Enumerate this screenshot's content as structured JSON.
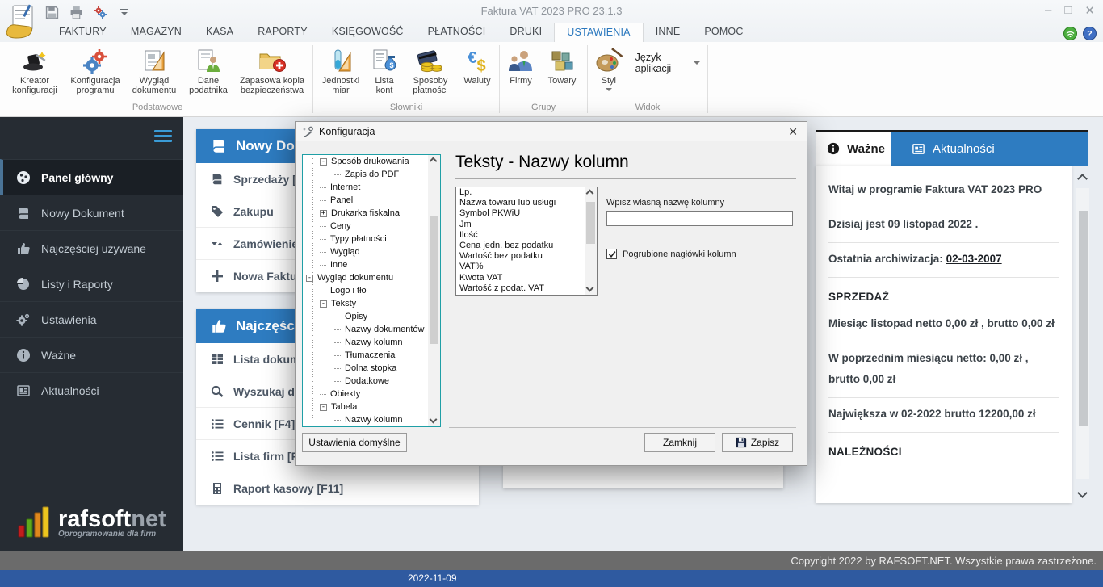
{
  "titlebar": {
    "title": "Faktura VAT 2023 PRO 23.1.3"
  },
  "tabs": {
    "items": [
      "FAKTURY",
      "MAGAZYN",
      "KASA",
      "RAPORTY",
      "KSIĘGOWOŚĆ",
      "PŁATNOŚCI",
      "DRUKI",
      "USTAWIENIA",
      "INNE",
      "POMOC"
    ],
    "active": "USTAWIENIA"
  },
  "ribbon": {
    "kreator": "Kreator konfiguracji",
    "konfiguracja": "Konfiguracja programu",
    "wyglad": "Wygląd dokumentu",
    "dane": "Dane podatnika",
    "kopia": "Zapasowa kopia bezpieczeństwa",
    "jednostki": "Jednostki miar",
    "lista_kont": "Lista kont",
    "sposoby": "Sposoby płatności",
    "waluty": "Waluty",
    "firmy": "Firmy",
    "towary": "Towary",
    "styl": "Styl",
    "jezyk": "Język aplikacji",
    "grp_podstawowe": "Podstawowe",
    "grp_slowniki": "Słowniki",
    "grp_grupy": "Grupy",
    "grp_widok": "Widok"
  },
  "sidebar": {
    "items": [
      "Panel główny",
      "Nowy Dokument",
      "Najczęściej używane",
      "Listy i Raporty",
      "Ustawienia",
      "Ważne",
      "Aktualności"
    ],
    "logo_bold": "rafsoft",
    "logo_light": "net",
    "logo_tagline": "Oprogramowanie dla firm"
  },
  "cards": {
    "c1_title": "Nowy Dok",
    "c1_items": [
      "Sprzedaży [",
      "Zakupu",
      "Zamówienie",
      "Nowa Faktu"
    ],
    "c2_title": "Najczęście",
    "c2_items": [
      "Lista dokum",
      "Wyszukaj d",
      "Cennik [F4]",
      "Lista firm [F",
      "Raport kasowy [F11]"
    ]
  },
  "dialog": {
    "title": "Konfiguracja",
    "heading": "Teksty - Nazwy kolumn",
    "tree": [
      {
        "exp": "-",
        "label": "Sposób drukowania"
      },
      {
        "label": "Zapis do PDF"
      },
      {
        "label": "Internet"
      },
      {
        "label": "Panel"
      },
      {
        "exp": "+",
        "label": "Drukarka fiskalna"
      },
      {
        "label": "Ceny"
      },
      {
        "label": "Typy płatności"
      },
      {
        "label": "Wygląd"
      },
      {
        "label": "Inne"
      },
      {
        "exp": "-",
        "label": "Wygląd dokumentu"
      },
      {
        "label": "Logo i tło"
      },
      {
        "exp": "-",
        "label": "Teksty"
      },
      {
        "label": "Opisy"
      },
      {
        "label": "Nazwy dokumentów"
      },
      {
        "label": "Nazwy kolumn"
      },
      {
        "label": "Tłumaczenia"
      },
      {
        "label": "Dolna stopka"
      },
      {
        "label": "Dodatkowe"
      },
      {
        "label": "Obiekty"
      },
      {
        "exp": "-",
        "label": "Tabela"
      },
      {
        "label": "Nazwy kolumn"
      }
    ],
    "listbox": [
      "Lp.",
      "Nazwa towaru lub usługi",
      "Symbol PKWiU",
      "Jm",
      "Ilość",
      "Cena jedn. bez podatku",
      "Wartość bez podatku",
      "VAT%",
      "Kwota VAT",
      "Wartość z podat. VAT"
    ],
    "input_label": "Wpisz własną nazwę kolumny",
    "input_value": "",
    "checkbox_label": "Pogrubione nagłówki kolumn",
    "checkbox_checked": true,
    "btn_defaults_pre": "Us",
    "btn_defaults_accel": "t",
    "btn_defaults_post": "awienia domyślne",
    "btn_close_pre": "Za",
    "btn_close_accel": "m",
    "btn_close_post": "knij",
    "btn_save_pre": "Za",
    "btn_save_accel": "p",
    "btn_save_post": "isz"
  },
  "panel": {
    "tab_wazne": "Ważne",
    "tab_aktualnosci": "Aktualności",
    "welcome": "Witaj w programie Faktura VAT 2023 PRO",
    "today": "Dzisiaj jest 09 listopad 2022 .",
    "archive_label": "Ostatnia archiwizacja: ",
    "archive_date": "02-03-2007",
    "sprzedaz": "SPRZEDAŻ",
    "line1": "Miesiąc listopad netto 0,00 zł , brutto 0,00 zł",
    "line2": "W poprzednim miesiącu netto: 0,00 zł , brutto 0,00 zł",
    "line3": "Największa w 02-2022 brutto 12200,00 zł",
    "naleznosci": "NALEŻNOŚCI"
  },
  "statusbar": {
    "copyright": "Copyright 2022 by RAFSOFT.NET. Wszystkie prawa zastrzeżone.",
    "date": "2022-11-09"
  },
  "colors": {
    "accent_blue": "#2e7cc1",
    "tab_active_blue": "#2b78be",
    "status_blue": "#2f5aa0",
    "bar_gray": "#6b6b6b",
    "sidebar_bg": "#262c33",
    "tree_border": "#1f9fa6",
    "hamburger_blue": "#3a9bd6"
  }
}
